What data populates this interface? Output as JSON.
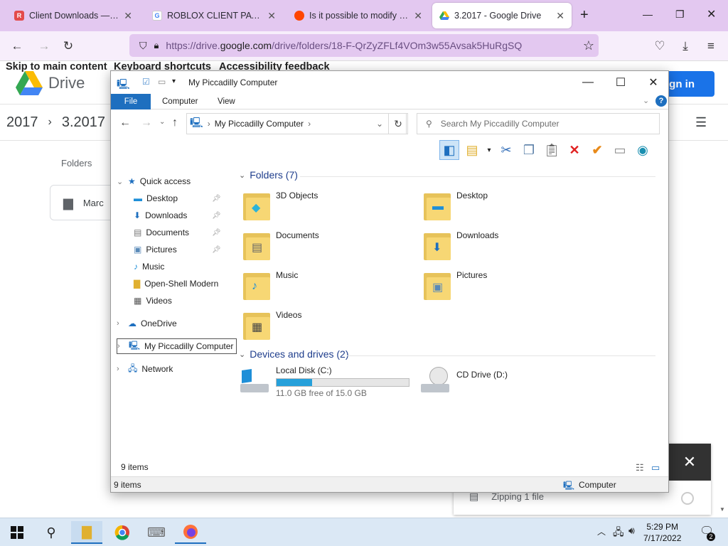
{
  "browser": {
    "tabs": [
      {
        "title": "Client Downloads — Old R",
        "color": "#e34b4b",
        "glyph": "R"
      },
      {
        "title": "ROBLOX CLIENT PATCHING",
        "color": "#333",
        "glyph": "G"
      },
      {
        "title": "Is it possible to modify the",
        "color": "#ff4500",
        "glyph": "●"
      },
      {
        "title": "3.2017 - Google Drive",
        "color": "#1a73e8",
        "glyph": "▲"
      }
    ],
    "url_prefix": "https://drive.",
    "url_domain": "google.com",
    "url_rest": "/drive/folders/18-F-QrZyZFLf4VOm3w55Avsak5HuRgSQ"
  },
  "drive": {
    "skip_main": "Skip to main content",
    "keyboard": "Keyboard shortcuts",
    "accessibility": "Accessibility feedback",
    "logo_text": "Drive",
    "sign_in": "Sign in",
    "breadcrumb": [
      "2017",
      "3.2017"
    ],
    "folders_label": "Folders",
    "folder_card": "Marc",
    "zipping": "Zipping 1 file"
  },
  "explorer": {
    "title": "My Piccadilly Computer",
    "ribbon_tabs": [
      "File",
      "Computer",
      "View"
    ],
    "address": "My Piccadilly Computer",
    "search_placeholder": "Search My Piccadilly Computer",
    "nav": {
      "quick_access": "Quick access",
      "items": [
        "Desktop",
        "Downloads",
        "Documents",
        "Pictures",
        "Music",
        "Open-Shell Modern",
        "Videos"
      ],
      "onedrive": "OneDrive",
      "computer": "My Piccadilly Computer",
      "network": "Network"
    },
    "folders_header": "Folders (7)",
    "folders": [
      "3D Objects",
      "Desktop",
      "Documents",
      "Downloads",
      "Music",
      "Pictures",
      "Videos"
    ],
    "devices_header": "Devices and drives (2)",
    "drive_c": {
      "name": "Local Disk (C:)",
      "free": "11.0 GB free of 15.0 GB",
      "used_fraction": 0.267
    },
    "drive_d": {
      "name": "CD Drive (D:)"
    },
    "items_count": "9 items",
    "status_items": "9 items",
    "status_computer": "Computer"
  },
  "taskbar": {
    "time": "5:29 PM",
    "date": "7/17/2022",
    "notif_count": "2"
  }
}
